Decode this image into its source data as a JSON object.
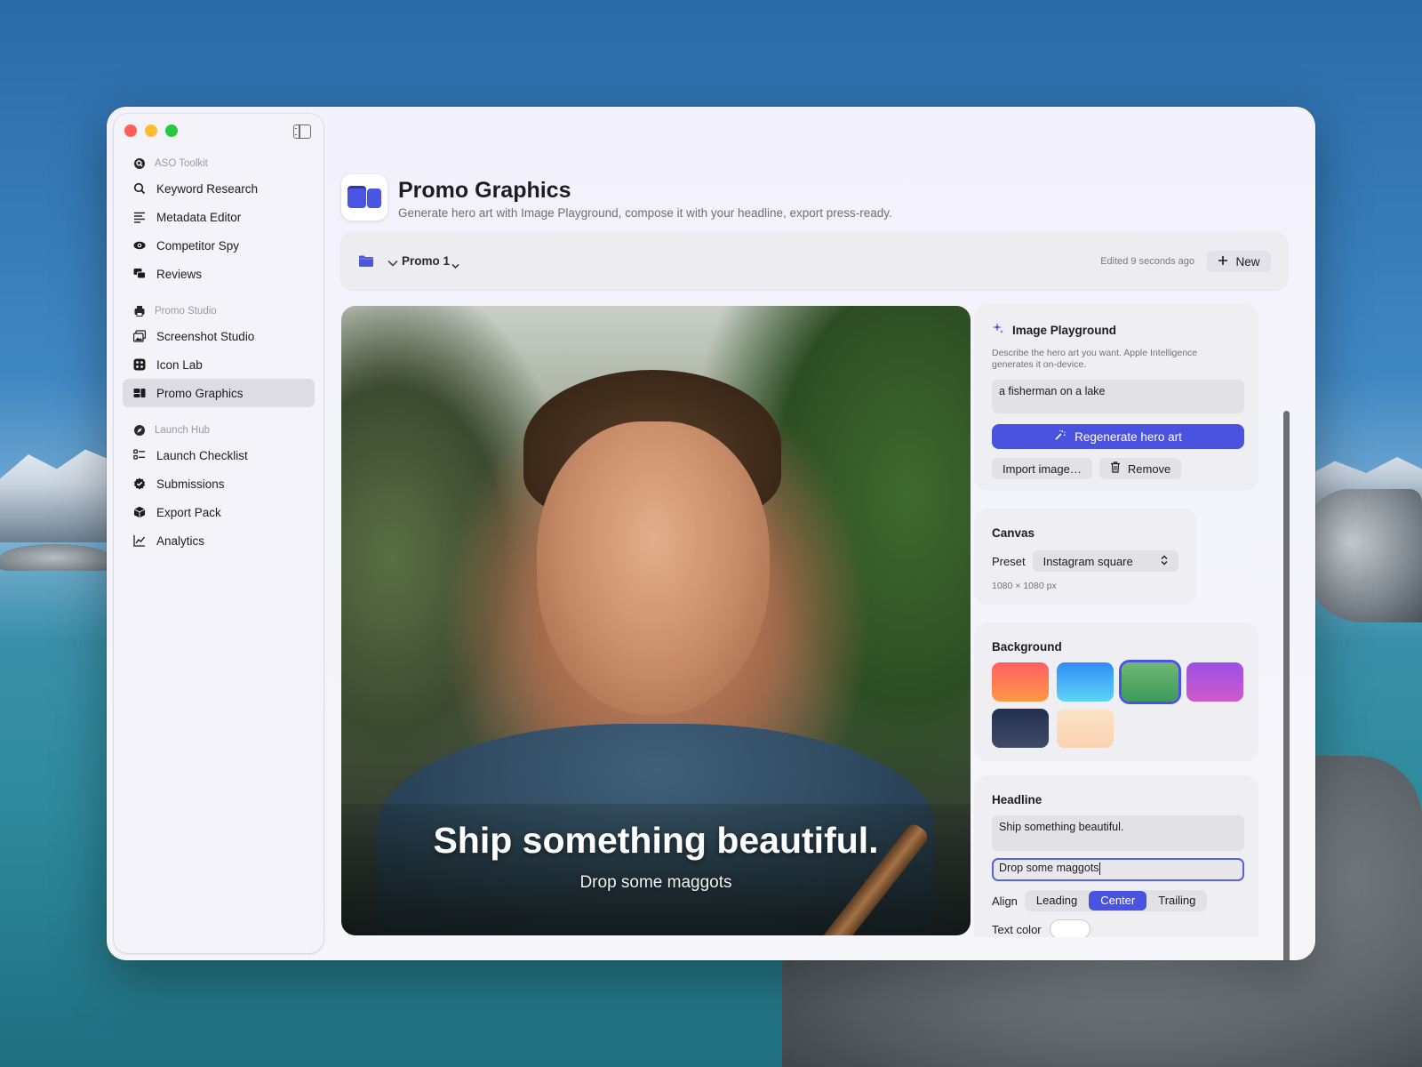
{
  "sidebar": {
    "sections": [
      {
        "label": "ASO Toolkit",
        "icon": "magnifier-badge-icon",
        "items": [
          {
            "label": "Keyword Research",
            "icon": "search-icon"
          },
          {
            "label": "Metadata Editor",
            "icon": "text-lines-icon"
          },
          {
            "label": "Competitor Spy",
            "icon": "eye-icon"
          },
          {
            "label": "Reviews",
            "icon": "chat-bubbles-icon"
          }
        ]
      },
      {
        "label": "Promo Studio",
        "icon": "printer-icon",
        "items": [
          {
            "label": "Screenshot Studio",
            "icon": "photos-icon"
          },
          {
            "label": "Icon Lab",
            "icon": "app-grid-icon"
          },
          {
            "label": "Promo Graphics",
            "icon": "layout-blocks-icon",
            "active": true
          }
        ]
      },
      {
        "label": "Launch Hub",
        "icon": "compass-icon",
        "items": [
          {
            "label": "Launch Checklist",
            "icon": "checklist-icon"
          },
          {
            "label": "Submissions",
            "icon": "check-seal-icon"
          },
          {
            "label": "Export Pack",
            "icon": "cube-icon"
          },
          {
            "label": "Analytics",
            "icon": "chart-line-icon"
          }
        ]
      }
    ]
  },
  "header": {
    "title": "Promo Graphics",
    "subtitle": "Generate hero art with Image Playground, compose it with your headline, export press-ready."
  },
  "toolbar": {
    "document_name": "Promo 1",
    "edited_status": "Edited 9 seconds ago",
    "new_label": "New"
  },
  "canvas": {
    "headline": "Ship something beautiful.",
    "subheadline": "Drop some maggots"
  },
  "image_playground": {
    "title": "Image Playground",
    "description": "Describe the hero art you want. Apple Intelligence generates it on-device.",
    "prompt_value": "a fisherman on a lake",
    "regenerate_label": "Regenerate hero art",
    "import_label": "Import image…",
    "remove_label": "Remove"
  },
  "canvas_settings": {
    "title": "Canvas",
    "preset_label": "Preset",
    "preset_value": "Instagram square",
    "dimensions": "1080 × 1080 px"
  },
  "background": {
    "title": "Background",
    "swatches": [
      {
        "name": "sunset",
        "from": "#ff5e62",
        "to": "#ff9a44"
      },
      {
        "name": "sky",
        "from": "#2f8cf5",
        "to": "#5fd4f7"
      },
      {
        "name": "forest",
        "from": "#6fb872",
        "to": "#3d9a5b",
        "selected": true
      },
      {
        "name": "violet",
        "from": "#9b4fe8",
        "to": "#d05ac9"
      },
      {
        "name": "midnight",
        "from": "#23304f",
        "to": "#3f4a66"
      },
      {
        "name": "peach",
        "from": "#fde3c9",
        "to": "#f9d2b0"
      }
    ]
  },
  "headline_settings": {
    "title": "Headline",
    "headline_value": "Ship something beautiful.",
    "subheadline_value": "Drop some maggots",
    "align_label": "Align",
    "align_options": [
      "Leading",
      "Center",
      "Trailing"
    ],
    "align_selected": "Center",
    "text_color_label": "Text color"
  },
  "colors": {
    "accent": "#4a52e0"
  }
}
